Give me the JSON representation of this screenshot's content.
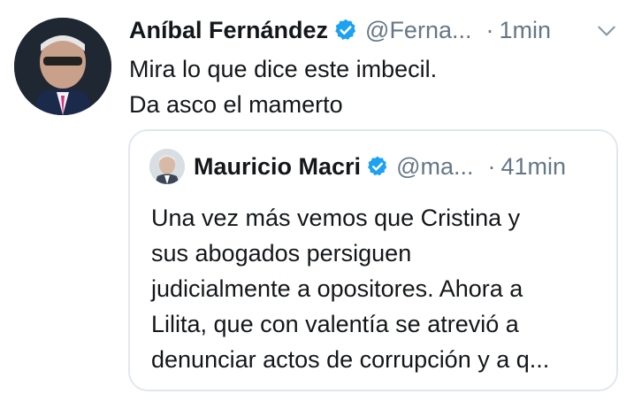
{
  "tweet": {
    "author_name": "Aníbal Fernández",
    "author_handle": "@Ferna...",
    "separator": "·",
    "time": "1min",
    "text_lines": [
      "Mira lo que dice este imbecil.",
      "Da asco el mamerto"
    ],
    "icons": {
      "verified": "verified-badge-icon",
      "menu": "chevron-down-icon"
    }
  },
  "quoted": {
    "author_name": "Mauricio Macri",
    "author_handle": "@ma...",
    "separator": "·",
    "time": "41min",
    "text_lines": [
      "Una vez más vemos que Cristina y",
      "sus abogados persiguen",
      "judicialmente a opositores. Ahora a",
      "Lilita, que con valentía se atrevió a",
      "denunciar actos de corrupción y a q..."
    ]
  },
  "colors": {
    "verified_blue": "#1da1f2",
    "secondary_text": "#657786",
    "border": "#e1e8ed"
  }
}
